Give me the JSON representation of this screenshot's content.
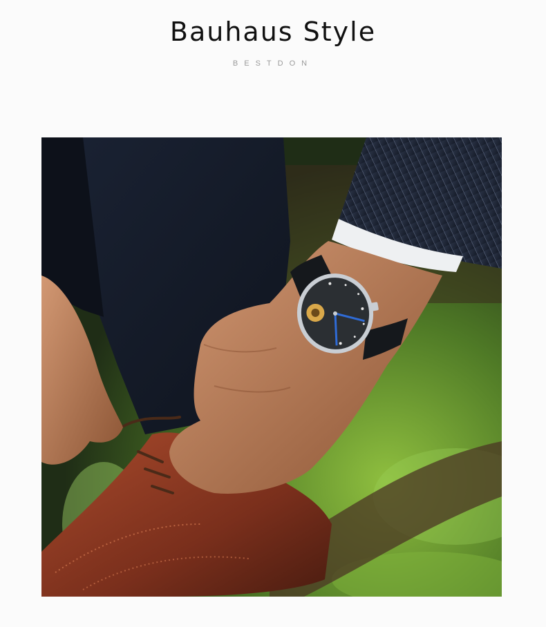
{
  "header": {
    "title": "Bauhaus Style",
    "subtitle": "BESTDON"
  },
  "photo": {
    "subject": "hand-tying-shoelace-wearing-watch",
    "colors": {
      "background": "#fbfbfb",
      "foliage": "#5f8a2c",
      "suit": "#1c2230",
      "shoe": "#8a3a22",
      "skin": "#b97a55",
      "watch_dial": "#2b2f33"
    }
  }
}
